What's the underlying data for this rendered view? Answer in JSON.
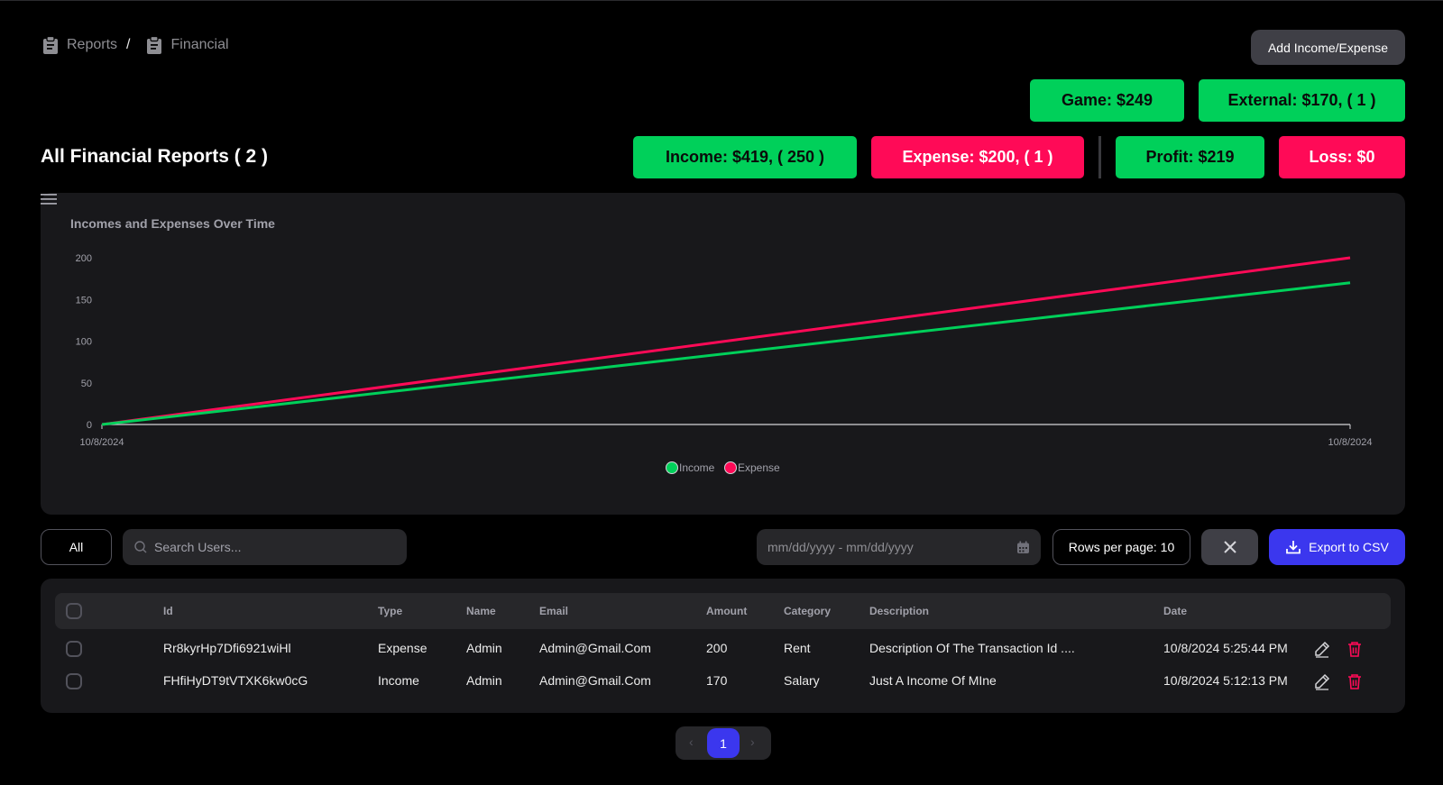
{
  "breadcrumb": {
    "items": [
      {
        "label": "Reports",
        "icon": "clipboard-icon"
      },
      {
        "label": "Financial",
        "icon": "clipboard-icon"
      }
    ],
    "separator": "/"
  },
  "header": {
    "add_button_label": "Add Income/Expense",
    "title": "All Financial Reports ( 2 )"
  },
  "stats": {
    "game": "Game:  $249",
    "external": "External:  $170, ( 1 )",
    "income": "Income:  $419, ( 250 )",
    "expense": "Expense:  $200, ( 1 )",
    "profit": "Profit:  $219",
    "loss": "Loss:  $0"
  },
  "colors": {
    "income": "#00d05a",
    "expense": "#ff0a57",
    "accent": "#3b37ee",
    "card": "#18181b"
  },
  "chart_data": {
    "type": "line",
    "title": "Incomes and Expenses Over Time",
    "x": [
      "10/8/2024",
      "10/8/2024"
    ],
    "series": [
      {
        "name": "Income",
        "values": [
          0,
          170
        ],
        "color": "#00d05a"
      },
      {
        "name": "Expense",
        "values": [
          0,
          200
        ],
        "color": "#ff0a57"
      }
    ],
    "yticks": [
      0,
      50,
      100,
      150,
      200
    ],
    "ylim": [
      0,
      200
    ],
    "grid": false,
    "legend": "bottom-center"
  },
  "toolbar": {
    "filter_label": "All",
    "search_placeholder": "Search Users...",
    "date_placeholder": "mm/dd/yyyy - mm/dd/yyyy",
    "rows_per_page_label": "Rows per page: 10",
    "export_label": "Export to CSV"
  },
  "table": {
    "columns": [
      "Id",
      "Type",
      "Name",
      "Email",
      "Amount",
      "Category",
      "Description",
      "Date"
    ],
    "rows": [
      {
        "id": "Rr8kyrHp7Dfi6921wiHl",
        "type": "Expense",
        "name": "Admin",
        "email": "Admin@Gmail.Com",
        "amount": "200",
        "category": "Rent",
        "description": "Description Of The Transaction Id ....",
        "date": "10/8/2024 5:25:44 PM"
      },
      {
        "id": "FHfiHyDT9tVTXK6kw0cG",
        "type": "Income",
        "name": "Admin",
        "email": "Admin@Gmail.Com",
        "amount": "170",
        "category": "Salary",
        "description": "Just A Income Of MIne",
        "date": "10/8/2024 5:12:13 PM"
      }
    ]
  },
  "pagination": {
    "current": "1",
    "prev": "‹",
    "next": "›"
  }
}
